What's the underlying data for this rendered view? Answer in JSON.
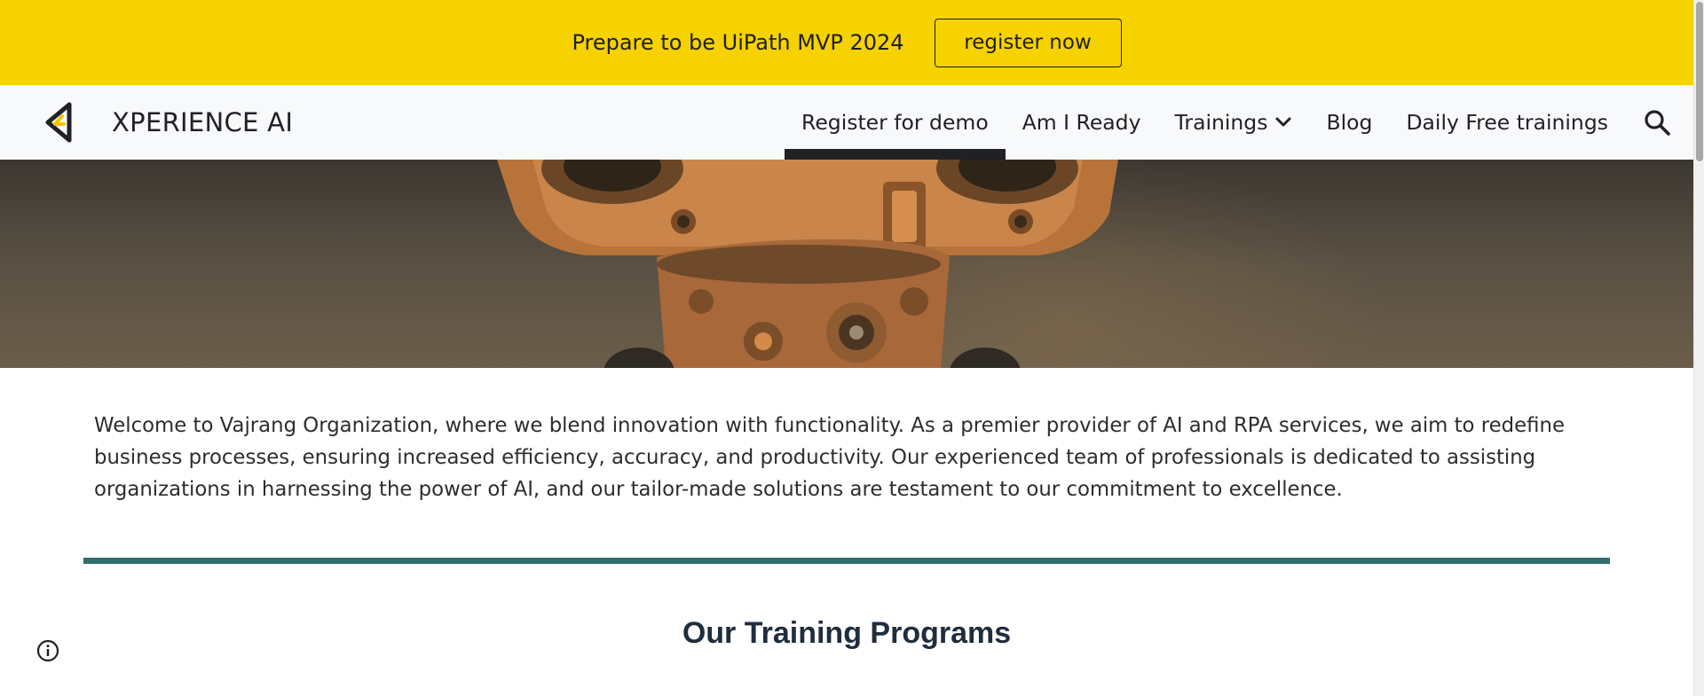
{
  "announcement": {
    "text": "Prepare to be UiPath MVP 2024",
    "button_label": "register now"
  },
  "header": {
    "site_title": "XPERIENCE AI",
    "logo_icon": "arrow-logo-icon",
    "nav": [
      {
        "label": "Register for demo",
        "active": true
      },
      {
        "label": "Am I Ready",
        "active": false
      },
      {
        "label": "Trainings",
        "active": false,
        "has_dropdown": true
      },
      {
        "label": "Blog",
        "active": false
      },
      {
        "label": "Daily Free trainings",
        "active": false
      }
    ],
    "search_icon": "search-icon"
  },
  "hero": {
    "image": "robot-hero-image"
  },
  "main": {
    "intro": "Welcome to Vajrang Organization, where we blend innovation with functionality. As a premier provider of AI and RPA services, we aim to redefine business processes, ensuring increased efficiency, accuracy, and productivity. Our experienced team of professionals is dedicated to assisting organizations in harnessing the power of AI, and our tailor-made solutions are testament to our commitment to excellence.",
    "section_title": "Our Training Programs"
  },
  "colors": {
    "announcement_bg": "#f5d200",
    "nav_bg": "#f8f9fa",
    "divider": "#2f6e6b"
  },
  "footer": {
    "info_icon": "info-icon"
  }
}
